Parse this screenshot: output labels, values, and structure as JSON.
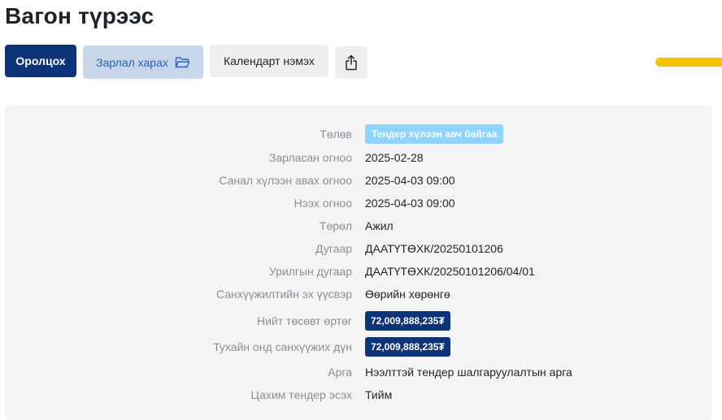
{
  "page": {
    "title": "Вагон түрээс"
  },
  "toolbar": {
    "participate_label": "Оролцох",
    "view_announcement_label": "Зарлал харах",
    "view_announcement_icon": "folder-icon",
    "add_calendar_label": "Календарт нэмэх",
    "share_icon": "share-icon"
  },
  "colors": {
    "primary": "#0d3476",
    "secondary_bg": "#c8d6ea",
    "secondary_text": "#2762b8",
    "status_badge": "#8fd3ff",
    "accent": "#f7c300",
    "card_bg": "#f4f4f4"
  },
  "info": {
    "status": {
      "label": "Төлөв",
      "value": "Тендер хүлээн авч байгаа"
    },
    "announced_date": {
      "label": "Зарласан огноо",
      "value": "2025-02-28"
    },
    "bid_deadline": {
      "label": "Санал хүлээн авах огноо",
      "value": "2025-04-03 09:00"
    },
    "opening_date": {
      "label": "Нээх огноо",
      "value": "2025-04-03 09:00"
    },
    "type": {
      "label": "Төрөл",
      "value": "Ажил"
    },
    "number": {
      "label": "Дугаар",
      "value": "ДААТҮТӨХК/20250101206"
    },
    "invitation_number": {
      "label": "Урилгын дугаар",
      "value": "ДААТҮТӨХК/20250101206/04/01"
    },
    "funding_source": {
      "label": "Санхүүжилтийн эх үүсвэр",
      "value": "Өөрийн хөрөнгө"
    },
    "total_budget": {
      "label": "Нийт төсөвт өртөг",
      "value": "72,009,888,235₮"
    },
    "annual_funding": {
      "label": "Тухайн онд санхүүжих дүн",
      "value": "72,009,888,235₮"
    },
    "method": {
      "label": "Арга",
      "value": "Нээлттэй тендер шалгаруулалтын арга"
    },
    "e_tender": {
      "label": "Цахим тендер эсэх",
      "value": "Тийм"
    }
  }
}
